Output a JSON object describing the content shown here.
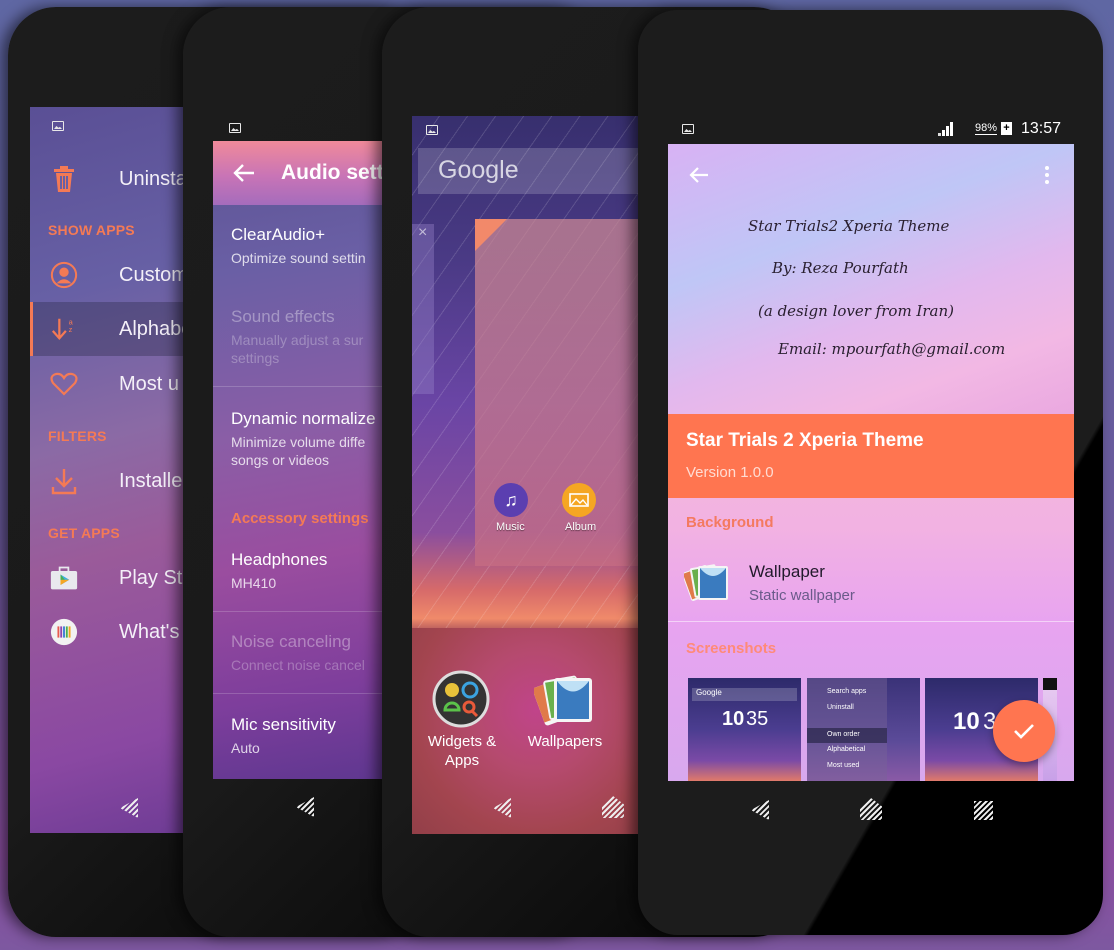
{
  "phone1": {
    "screen": "app-drawer-menu",
    "items": [
      {
        "type": "item",
        "icon": "trash-icon",
        "label": "Uninsta"
      },
      {
        "type": "section",
        "label": "SHOW APPS"
      },
      {
        "type": "item",
        "icon": "person-circle-icon",
        "label": "Custom"
      },
      {
        "type": "item",
        "icon": "sort-alphabetical-icon",
        "label": "Alphabe",
        "active": true
      },
      {
        "type": "item",
        "icon": "heart-icon",
        "label": "Most u"
      },
      {
        "type": "section",
        "label": "FILTERS"
      },
      {
        "type": "item",
        "icon": "download-icon",
        "label": "Installe"
      },
      {
        "type": "section",
        "label": "GET APPS"
      },
      {
        "type": "item",
        "icon": "play-store-icon",
        "label": "Play Sto"
      },
      {
        "type": "item",
        "icon": "whats-new-icon",
        "label": "What's"
      }
    ]
  },
  "phone2": {
    "header_title": "Audio sett",
    "items": [
      {
        "title": "ClearAudio+",
        "subtitle": "Optimize sound settin",
        "disabled": false
      },
      {
        "title": "Sound effects",
        "subtitle": "Manually adjust a sur",
        "subtitle2": "settings",
        "disabled": true
      },
      {
        "title": "Dynamic normalize",
        "subtitle": "Minimize volume diffe",
        "subtitle2": "songs or videos",
        "disabled": false
      }
    ],
    "section": "Accessory settings",
    "items2": [
      {
        "title": "Headphones",
        "subtitle": "MH410",
        "disabled": false
      },
      {
        "title": "Noise canceling",
        "subtitle": "Connect noise cancel",
        "disabled": true
      },
      {
        "title": "Mic sensitivity",
        "subtitle": "Auto",
        "disabled": false
      }
    ]
  },
  "phone3": {
    "search_label": "Google",
    "dock_apps": [
      {
        "label": "Music",
        "icon": "music-note-icon",
        "color": "#5b3fb0"
      },
      {
        "label": "Album",
        "icon": "album-icon",
        "color": "#f5a623"
      }
    ],
    "options": [
      {
        "label_line1": "Widgets &",
        "label_line2": "Apps",
        "icon": "widgets-apps-icon"
      },
      {
        "label_line1": "Wallpapers",
        "label_line2": "",
        "icon": "wallpapers-icon"
      }
    ]
  },
  "phone4": {
    "status": {
      "battery": "98%",
      "time": "13:57"
    },
    "hero_lines": [
      "Star Trials2 Xperia Theme",
      "By: Reza Pourfath",
      "(a design lover from Iran)",
      "Email: mpourfath@gmail.com"
    ],
    "title": "Star Trials 2 Xperia Theme",
    "version": "Version 1.0.0",
    "background_section": "Background",
    "wallpaper": {
      "title": "Wallpaper",
      "subtitle": "Static wallpaper"
    },
    "screenshots_section": "Screenshots",
    "screenshots": [
      {
        "clock_hour": "10",
        "clock_min": "35",
        "search": "Google"
      },
      {
        "menu": [
          "Search apps",
          "Uninstall",
          "Own order",
          "Alphabetical",
          "Most used"
        ]
      },
      {
        "clock_hour": "10",
        "clock_min": "3"
      }
    ],
    "accent_color": "#ff7550"
  },
  "colors": {
    "accent": "#f47a55",
    "banner": "#ff7550"
  }
}
